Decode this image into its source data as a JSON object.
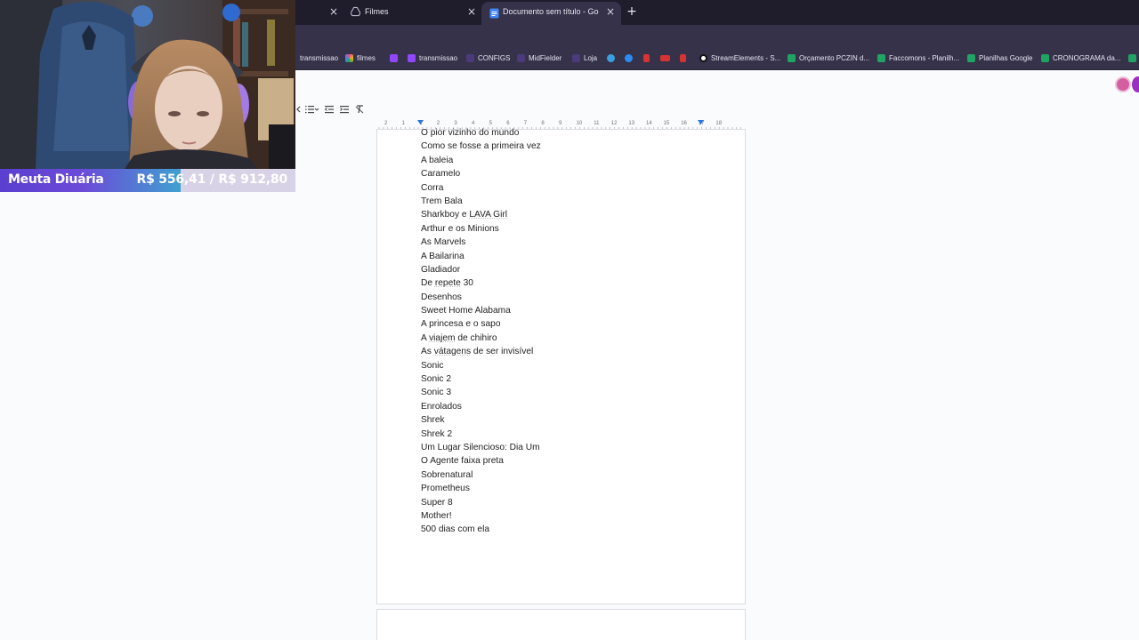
{
  "browser": {
    "tabs": [
      {
        "title": "",
        "active": false
      },
      {
        "title": "Filmes",
        "active": false
      },
      {
        "title": "Documento sem título - Googl",
        "active": true
      }
    ],
    "new_tab_label": "+",
    "close_glyph": "×",
    "bookmarks": [
      {
        "label": "transmissao",
        "icon": "generic-icon",
        "color": "#35324a"
      },
      {
        "label": "filmes",
        "icon": "folder-color-icon",
        "color": "#e24d8f"
      },
      {
        "label": "",
        "icon": "twitch-icon",
        "color": "#9146ff"
      },
      {
        "label": "transmissao",
        "icon": "twitch-icon",
        "color": "#9146ff"
      },
      {
        "label": "CONFIGS",
        "icon": "twitch-dark-icon",
        "color": "#4b3b7a"
      },
      {
        "label": "MidFielder",
        "icon": "twitch-dark-icon",
        "color": "#4b3b7a"
      },
      {
        "label": "Loja",
        "icon": "twitch-dark-icon",
        "color": "#4b3b7a"
      },
      {
        "label": "",
        "icon": "globe-icon",
        "color": "#3aa0e0"
      },
      {
        "label": "",
        "icon": "edge-icon",
        "color": "#2d8cf0"
      },
      {
        "label": "",
        "icon": "red-doc-icon",
        "color": "#d63333"
      },
      {
        "label": "",
        "icon": "red-mail-icon",
        "color": "#d63333"
      },
      {
        "label": "",
        "icon": "red-doc-icon",
        "color": "#d63333"
      },
      {
        "label": "StreamElements - S...",
        "icon": "streamelements-icon",
        "color": "#ffffff"
      },
      {
        "label": "Orçamento PCZIN d...",
        "icon": "sheets-icon",
        "color": "#1fa463"
      },
      {
        "label": "Faccomons - Planilh...",
        "icon": "sheets-icon",
        "color": "#1fa463"
      },
      {
        "label": "Planilhas Google",
        "icon": "sheets-icon",
        "color": "#1fa463"
      },
      {
        "label": "CRONOGRAMA da...",
        "icon": "sheets-icon",
        "color": "#1fa463"
      },
      {
        "label": "",
        "icon": "sheets-icon",
        "color": "#1fa463"
      }
    ]
  },
  "ruler": {
    "numbers": [
      "2",
      "1",
      "1",
      "2",
      "3",
      "4",
      "5",
      "6",
      "7",
      "8",
      "9",
      "10",
      "11",
      "12",
      "13",
      "14",
      "15",
      "16",
      "17",
      "18"
    ]
  },
  "document": {
    "lines": [
      "O pior vizinho do mundo",
      "Como se fosse a primeira vez",
      "A baleia",
      "Caramelo",
      "Corra",
      "Trem Bala",
      "Sharkboy e LAVA Girl",
      "Arthur e os Minions",
      "As Marvels",
      "A Bailarina",
      "Gladiador",
      "De repete 30",
      "Desenhos",
      "Sweet Home Alabama",
      "A princesa e o sapo",
      "A viajem de chihiro",
      "As vátagens de ser invisível",
      "Sonic",
      "Sonic 2",
      "Sonic 3",
      "Enrolados",
      "Shrek",
      "Shrek 2",
      "Um Lugar Silencioso: Dia Um",
      "O Agente faixa preta",
      "Sobrenatural",
      "Prometheus",
      "Super 8",
      "Mother!",
      "500 dias com ela"
    ]
  },
  "stream_overlay": {
    "label": "Meuta Diuária",
    "current": "R$ 556,41",
    "separator": " / ",
    "goal": "R$ 912,80",
    "progress": 0.61
  },
  "colors": {
    "docs_bg": "#f9fbfd",
    "chrome_dark": "#1f1d2b",
    "chrome_mid": "#35324a",
    "sheets_green": "#1fa463"
  }
}
